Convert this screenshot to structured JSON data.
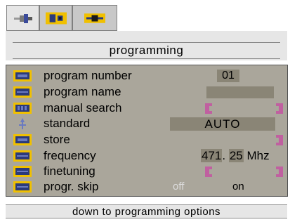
{
  "tabs": [
    {
      "icon": "plug-icon",
      "active": false
    },
    {
      "icon": "tv-input-icon",
      "active": true
    },
    {
      "icon": "plug-highlight-icon",
      "active": true
    }
  ],
  "header": {
    "title": "programming"
  },
  "menu": {
    "rows": [
      {
        "label": "program number",
        "icon": "program-number-icon",
        "value": "01"
      },
      {
        "label": "program name",
        "icon": "program-name-icon"
      },
      {
        "label": "manual search",
        "icon": "manual-search-icon"
      },
      {
        "label": "standard",
        "icon": "standard-icon",
        "value": "AUTO"
      },
      {
        "label": "store",
        "icon": "store-icon"
      },
      {
        "label": "frequency",
        "icon": "frequency-icon",
        "value_main": "471",
        "value_sep": ".",
        "value_dec": "25",
        "unit": "Mhz"
      },
      {
        "label": "finetuning",
        "icon": "finetuning-icon"
      },
      {
        "label": "progr. skip",
        "icon": "skip-icon",
        "option_off": "off",
        "option_on": "on"
      }
    ]
  },
  "footer": {
    "hint": "down to programming options"
  },
  "colors": {
    "menu_bg": "#aaa69b",
    "field_bg": "#8a8576",
    "icon_yellow": "#f0c000",
    "icon_blue": "#2b3a7a",
    "arrow": "#c060a0"
  }
}
